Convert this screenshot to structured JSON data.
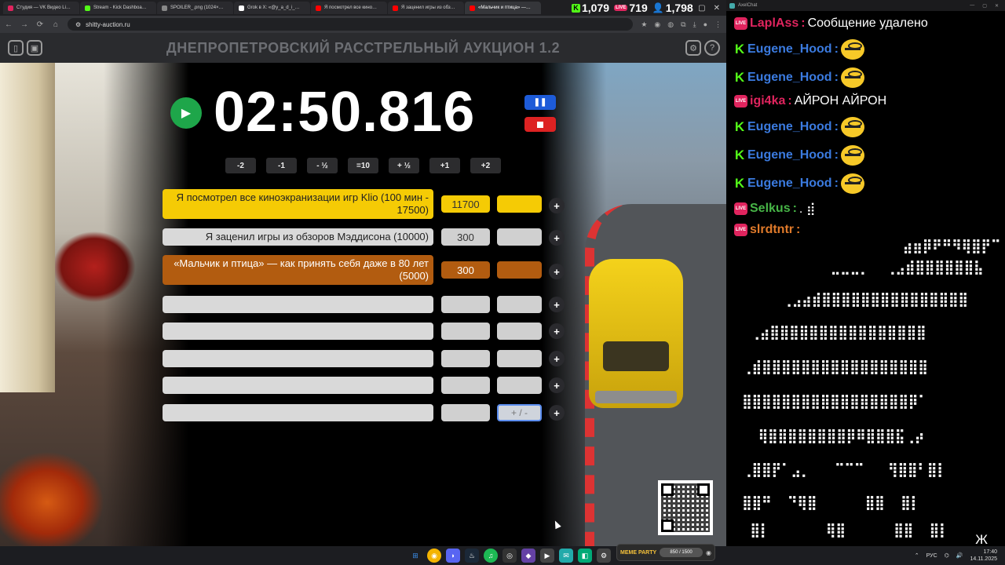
{
  "browser": {
    "tabs": [
      {
        "label": "Студия — VK Видео Li…",
        "color": "#e0245e"
      },
      {
        "label": "Stream - Kick Dashboa…",
        "color": "#53fc18"
      },
      {
        "label": "SPOILER_.png (1024×…",
        "color": "#888888"
      },
      {
        "label": "Grok в X: «@y_a_d_i_…",
        "color": "#ffffff"
      },
      {
        "label": "Я посмотрел все кино…",
        "color": "#ff0000"
      },
      {
        "label": "Я заценил игры из обз…",
        "color": "#ff0000"
      },
      {
        "label": "«Мальчик и птица» —…",
        "color": "#ff0000"
      }
    ],
    "url": "shitty-auction.ru"
  },
  "stream_stats": {
    "kick_viewers": "1,079",
    "live_badge": "LIVE",
    "live_viewers": "719",
    "total_viewers": "1,798"
  },
  "app": {
    "title": "ДНЕПРОПЕТРОВСКИЙ РАССТРЕЛЬНЫЙ АУКЦИОН 1.2",
    "timer": "02:50.816",
    "adjust_buttons": [
      "-2",
      "-1",
      "- ½",
      "=10",
      "+ ½",
      "+1",
      "+2"
    ],
    "lots": [
      {
        "name": "Я посмотрел все киноэкранизации игр Klio (100 мин - 17500)",
        "sum": "11700",
        "color": "#f5cb05"
      },
      {
        "name": "Я заценил игры из обзоров Мэддисона (10000)",
        "sum": "300",
        "color": "#d9d9d9"
      },
      {
        "name": "«Мальчик и птица» — как принять себя даже в 80 лет (5000)",
        "sum": "300",
        "color": "#b25c10"
      },
      {
        "name": "",
        "sum": "",
        "color": "#d9d9d9"
      },
      {
        "name": "",
        "sum": "",
        "color": "#d9d9d9"
      },
      {
        "name": "",
        "sum": "",
        "color": "#d9d9d9"
      },
      {
        "name": "",
        "sum": "",
        "color": "#d9d9d9"
      },
      {
        "name": "",
        "sum": "",
        "color": "#d9d9d9"
      }
    ],
    "add_placeholder": "+ / -"
  },
  "chat": {
    "window_title": "AxelChat",
    "messages": [
      {
        "platform": "live",
        "user": "LaplAss",
        "user_color": "#e0245e",
        "text": "Сообщение удалено"
      },
      {
        "platform": "kick",
        "user": "Eugene_Hood",
        "user_color": "#3b7be0",
        "text": ""
      },
      {
        "platform": "kick",
        "user": "Eugene_Hood",
        "user_color": "#3b7be0",
        "text": ""
      },
      {
        "platform": "live",
        "user": "igi4ka",
        "user_color": "#e0245e",
        "text": "АЙРОН АЙРОН"
      },
      {
        "platform": "kick",
        "user": "Eugene_Hood",
        "user_color": "#3b7be0",
        "text": ""
      },
      {
        "platform": "kick",
        "user": "Eugene_Hood",
        "user_color": "#3b7be0",
        "text": ""
      },
      {
        "platform": "kick",
        "user": "Eugene_Hood",
        "user_color": "#3b7be0",
        "text": ""
      },
      {
        "platform": "live",
        "user": "Selkus",
        "user_color": "#47b547",
        "text": ". ⣾"
      },
      {
        "platform": "live",
        "user": "slrdtntr",
        "user_color": "#e07a2a",
        "text": ""
      }
    ],
    "braille_lines": [
      "                     ⣴⣶⡿⠟⠛⠻⢿⣿⡟⠉",
      "            ⣀⣀⣀⡀  ⢀⣠⣾⣿⣿⣿⣿⣿⣿⣧",
      "      ⢀⣠⣴⣾⣿⣿⣿⣿⣿⣿⣿⣿⣿⣿⣿⣿⣿⣿⣿",
      "  ⢀⣴⣿⣿⣿⣿⣿⣿⣿⣿⣿⣿⣿⣿⣿⣿⣿⣿",
      " ⢀⣾⣿⣿⣿⣿⣿⣿⣿⣿⣿⣿⣿⣿⣿⣿⣿⣿⣿",
      " ⣿⣿⣿⣿⣿⣿⣿⣿⣿⣿⣿⣿⣿⣿⣿⣿⣿⡿⠁",
      "   ⢿⣿⣿⣿⣿⣿⣿⣿⣿⡿⠿⣿⣿⣿⣯⢀⡴",
      " ⢀⣿⣿⡟⠁⣠⡀   ⠉⠉⠉   ⢻⣿⣿⠃⣿⡇",
      " ⣿⣿⠛  ⠙⢿⣿      ⣿⣿  ⣿⡇",
      "  ⣿⡇       ⢿⣿      ⣿⣿  ⣿⡇"
    ],
    "trailing_char": "Ж"
  },
  "taskbar": {
    "lang": "РУС",
    "time": "17:40",
    "date": "14.11.2025",
    "widget_label": "MEME PARTY",
    "widget_progress": "850 / 1500"
  }
}
